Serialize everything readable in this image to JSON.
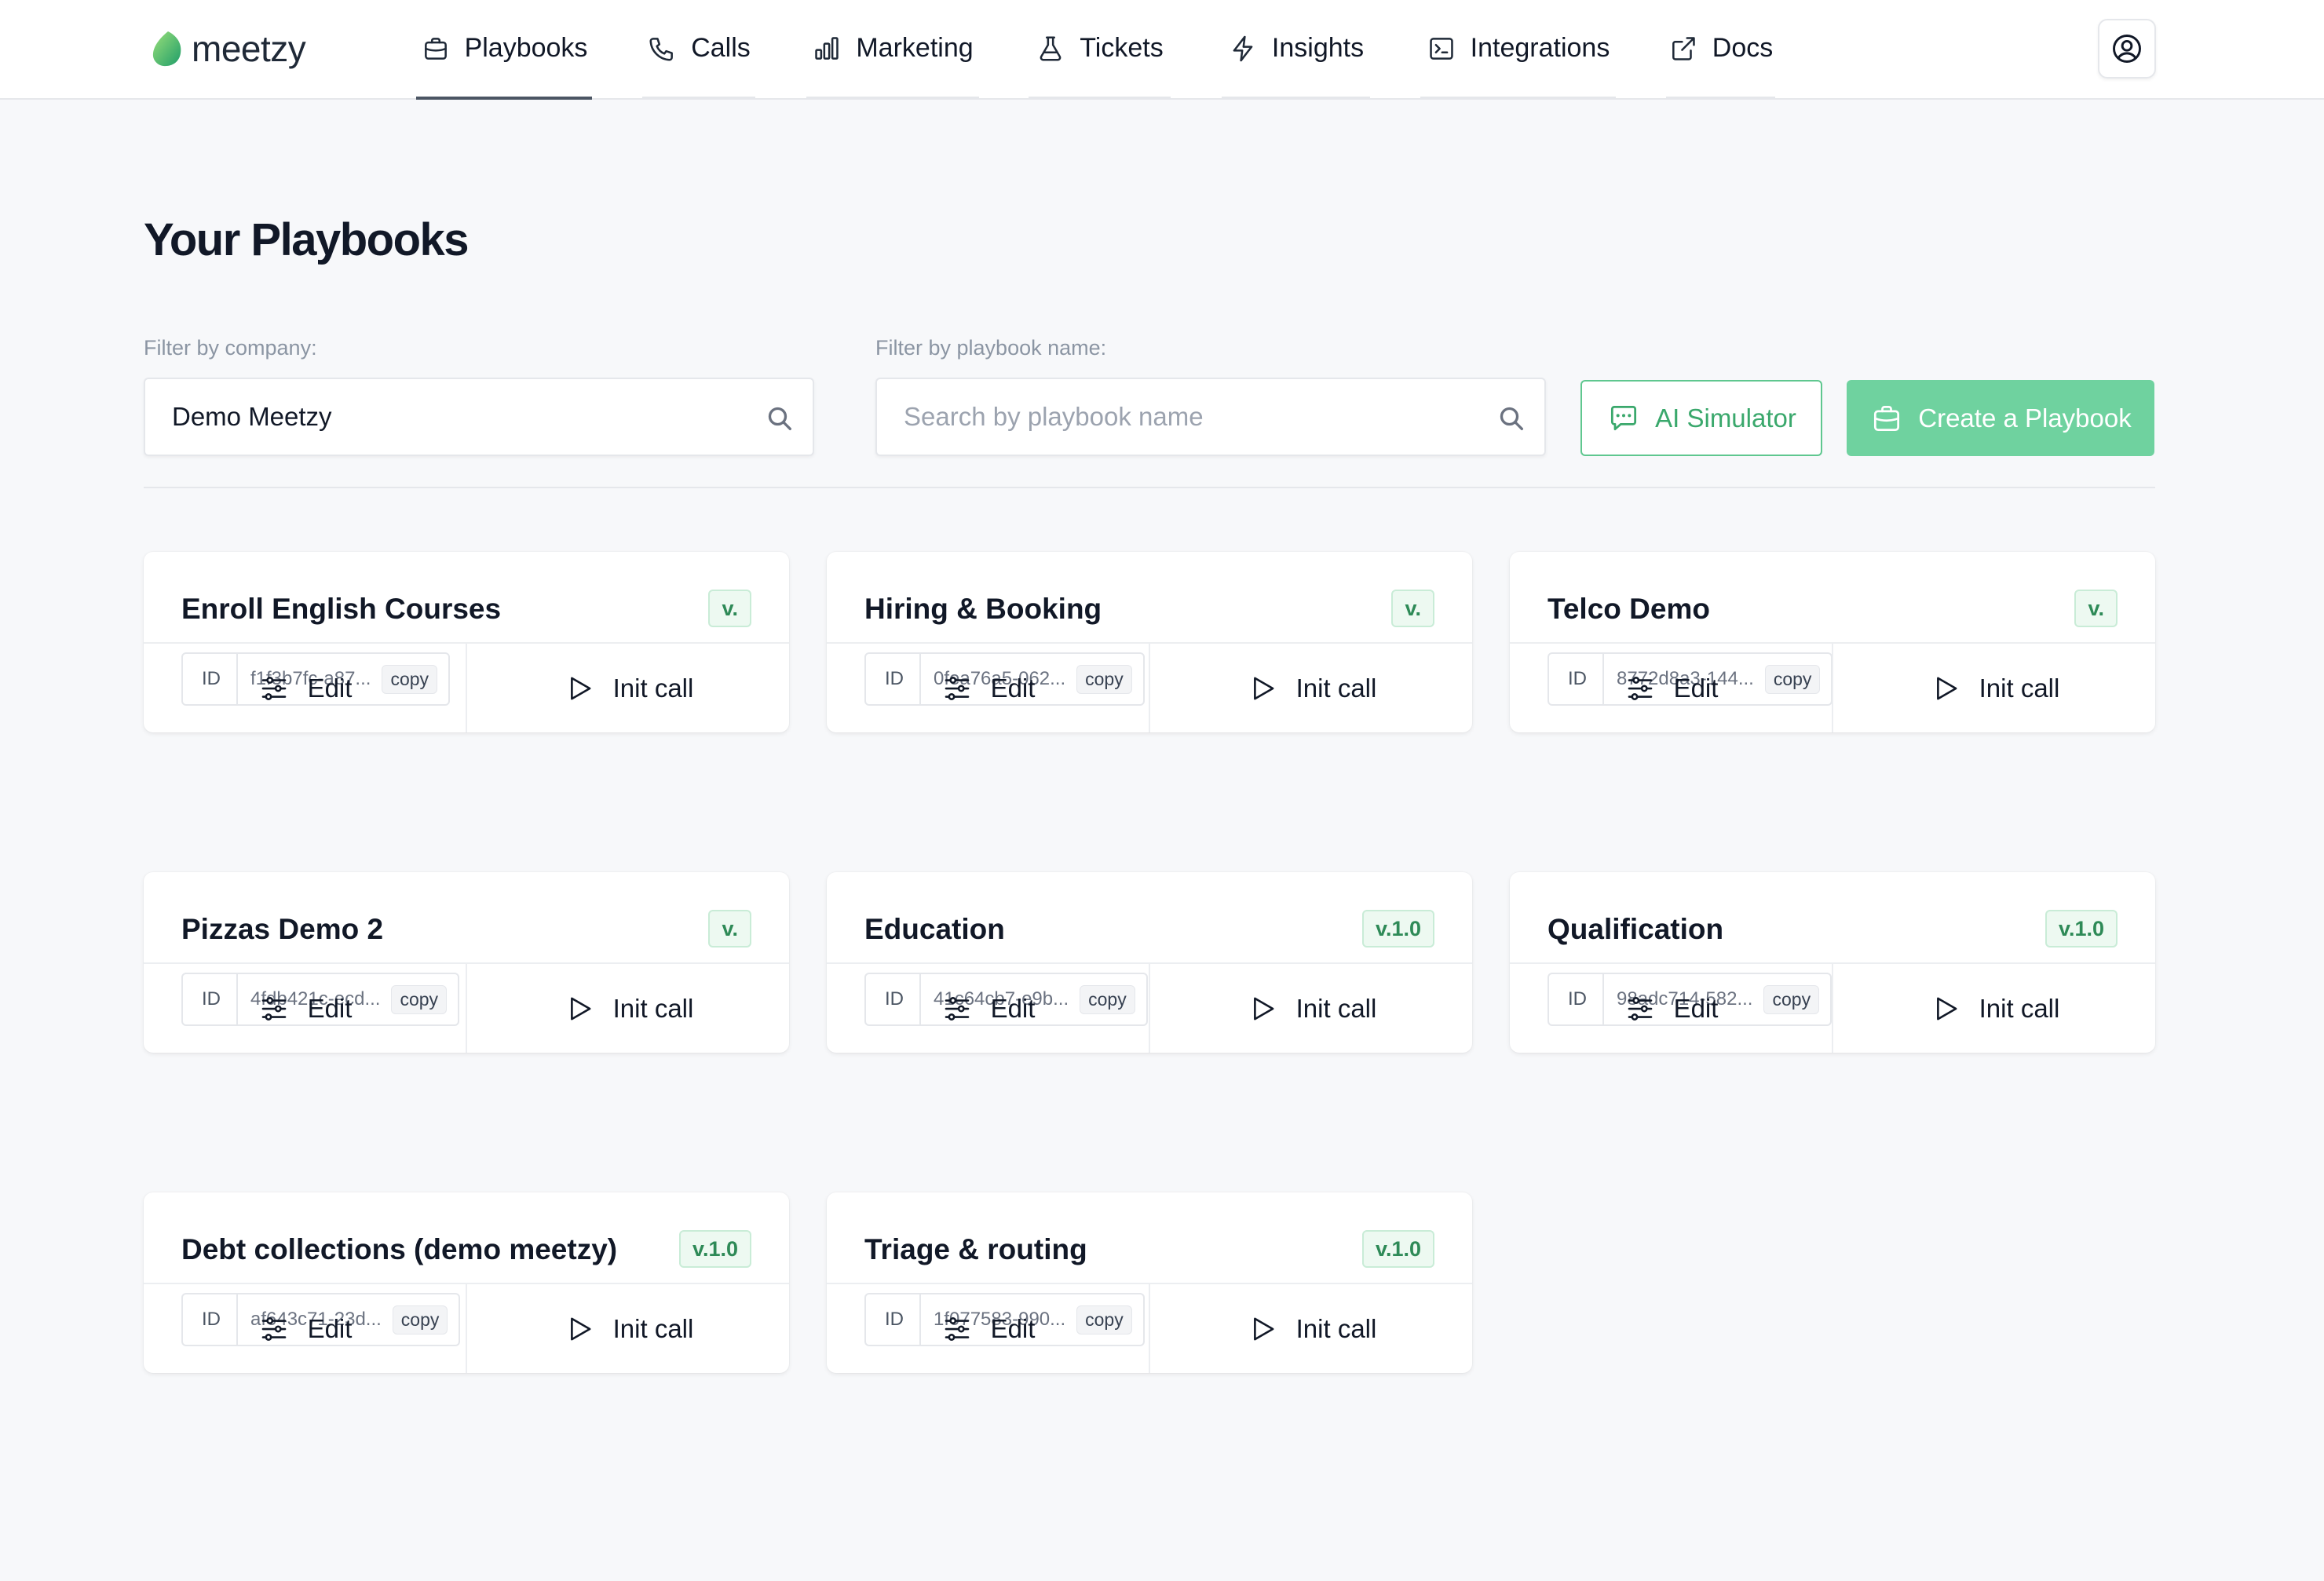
{
  "app": {
    "logo_text": "meetzy",
    "brand_color": "#5cc68f"
  },
  "nav": {
    "tabs": [
      {
        "label": "Playbooks",
        "icon": "briefcase-icon",
        "active": true
      },
      {
        "label": "Calls",
        "icon": "phone-icon",
        "active": false
      },
      {
        "label": "Marketing",
        "icon": "bar-chart-icon",
        "active": false
      },
      {
        "label": "Tickets",
        "icon": "flask-icon",
        "active": false
      },
      {
        "label": "Insights",
        "icon": "lightning-icon",
        "active": false
      },
      {
        "label": "Integrations",
        "icon": "terminal-icon",
        "active": false
      },
      {
        "label": "Docs",
        "icon": "external-link-icon",
        "active": false
      }
    ],
    "profile_icon": "user-circle-icon"
  },
  "page": {
    "title": "Your Playbooks"
  },
  "filters": {
    "company_label": "Filter by company:",
    "company_value": "Demo Meetzy",
    "name_label": "Filter by playbook name:",
    "name_placeholder": "Search by playbook name",
    "name_value": ""
  },
  "actions": {
    "simulator_label": "AI Simulator",
    "create_label": "Create a Playbook"
  },
  "cards": [
    {
      "title": "Enroll English Courses",
      "version": "v.",
      "id_label": "ID",
      "id_value": "f1f3b7fc-a87...",
      "copy_label": "copy",
      "edit_label": "Edit",
      "init_label": "Init call"
    },
    {
      "title": "Hiring & Booking",
      "version": "v.",
      "id_label": "ID",
      "id_value": "0fea76a5-062...",
      "copy_label": "copy",
      "edit_label": "Edit",
      "init_label": "Init call"
    },
    {
      "title": "Telco Demo",
      "version": "v.",
      "id_label": "ID",
      "id_value": "8772d8a3-144...",
      "copy_label": "copy",
      "edit_label": "Edit",
      "init_label": "Init call"
    },
    {
      "title": "Pizzas Demo 2",
      "version": "v.",
      "id_label": "ID",
      "id_value": "4fdb421c-ecd...",
      "copy_label": "copy",
      "edit_label": "Edit",
      "init_label": "Init call"
    },
    {
      "title": "Education",
      "version": "v.1.0",
      "id_label": "ID",
      "id_value": "41c64cb7-e9b...",
      "copy_label": "copy",
      "edit_label": "Edit",
      "init_label": "Init call"
    },
    {
      "title": "Qualification",
      "version": "v.1.0",
      "id_label": "ID",
      "id_value": "98adc714-582...",
      "copy_label": "copy",
      "edit_label": "Edit",
      "init_label": "Init call"
    },
    {
      "title": "Debt collections (demo meetzy)",
      "version": "v.1.0",
      "id_label": "ID",
      "id_value": "af643c71-23d...",
      "copy_label": "copy",
      "edit_label": "Edit",
      "init_label": "Init call"
    },
    {
      "title": "Triage & routing",
      "version": "v.1.0",
      "id_label": "ID",
      "id_value": "1f077583-990...",
      "copy_label": "copy",
      "edit_label": "Edit",
      "init_label": "Init call"
    }
  ]
}
